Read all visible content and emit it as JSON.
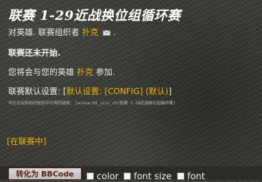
{
  "title": "联赛 1-29近战换位组循环赛",
  "organizer": {
    "prefix": "对英雄. 联赛组织者",
    "name": "扑克",
    "suffix": "."
  },
  "status": "联赛还未开始.",
  "join": {
    "prefix": "您将会与您的英雄",
    "hero": "扑克",
    "suffix": "参加."
  },
  "defaults": {
    "prefix": "联赛默认设置: [",
    "values": "默认设置: [CONFIG] (默认)",
    "suffix": "]"
  },
  "embed_note": "可在论坛和站内短信中引用的链接: [arena:69_join_cb|联赛 1-29近战换位组循环赛]",
  "in_league": {
    "open": "[",
    "link": "在联赛中",
    "close": "]"
  },
  "toolbar": {
    "bbcode_button": "转化为 BBCode",
    "options": [
      "color",
      "font size",
      "font"
    ]
  },
  "colors": {
    "link": "#f2b600",
    "text": "#f0f0f0",
    "background": "#3a3a36"
  },
  "icons": {
    "mail": "mail-icon"
  }
}
